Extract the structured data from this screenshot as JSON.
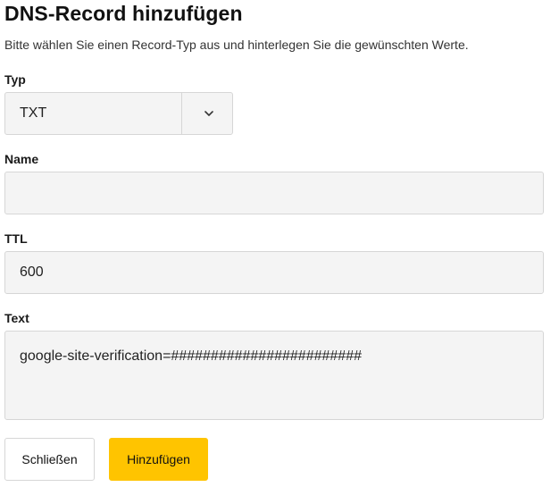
{
  "dialog": {
    "title": "DNS-Record hinzufügen",
    "subtitle": "Bitte wählen Sie einen Record-Typ aus und hinterlegen Sie die gewünschten Werte."
  },
  "fields": {
    "type": {
      "label": "Typ",
      "value": "TXT"
    },
    "name": {
      "label": "Name",
      "value": ""
    },
    "ttl": {
      "label": "TTL",
      "value": "600"
    },
    "text": {
      "label": "Text",
      "value": "google-site-verification=########################"
    }
  },
  "buttons": {
    "close_label": "Schließen",
    "add_label": "Hinzufügen"
  },
  "colors": {
    "accent": "#ffc400",
    "field_background": "#f4f4f4",
    "field_border": "#d6d6d6"
  },
  "icons": {
    "select_indicator": "chevron-down-icon"
  }
}
